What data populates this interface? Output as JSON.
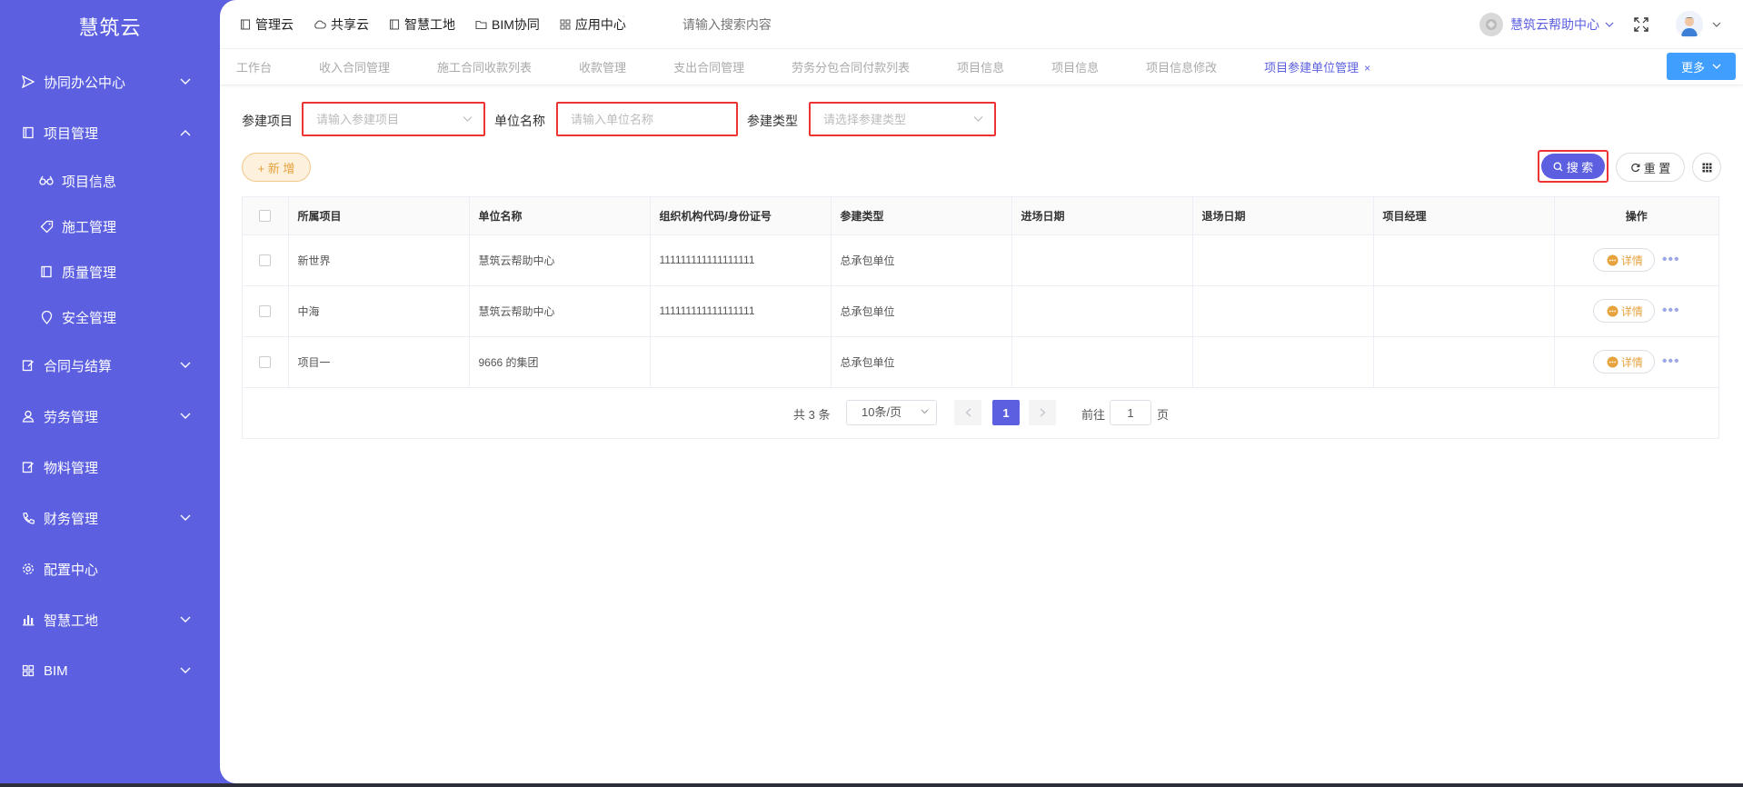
{
  "app": {
    "logo": "慧筑云"
  },
  "sidebar": {
    "items": [
      {
        "label": "协同办公中心",
        "icon": "send-icon",
        "expanded": false
      },
      {
        "label": "项目管理",
        "icon": "book-icon",
        "expanded": true,
        "children": [
          {
            "label": "项目信息",
            "icon": "glasses-icon"
          },
          {
            "label": "施工管理",
            "icon": "tag-icon"
          },
          {
            "label": "质量管理",
            "icon": "book-icon"
          },
          {
            "label": "安全管理",
            "icon": "location-icon"
          }
        ]
      },
      {
        "label": "合同与结算",
        "icon": "edit-icon",
        "expanded": false
      },
      {
        "label": "劳务管理",
        "icon": "user-icon",
        "expanded": false
      },
      {
        "label": "物料管理",
        "icon": "edit-icon"
      },
      {
        "label": "财务管理",
        "icon": "phone-icon",
        "expanded": false
      },
      {
        "label": "配置中心",
        "icon": "gear-icon"
      },
      {
        "label": "智慧工地",
        "icon": "bar-chart-icon",
        "expanded": false
      },
      {
        "label": "BIM",
        "icon": "grid-icon",
        "expanded": false
      }
    ]
  },
  "topnav": {
    "items": [
      {
        "label": "管理云",
        "icon": "book-icon"
      },
      {
        "label": "共享云",
        "icon": "cloud-icon"
      },
      {
        "label": "智慧工地",
        "icon": "book-icon"
      },
      {
        "label": "BIM协同",
        "icon": "folder-icon"
      },
      {
        "label": "应用中心",
        "icon": "grid-icon"
      }
    ],
    "search_placeholder": "请输入搜索内容",
    "help_center": "慧筑云帮助中心"
  },
  "tabs": {
    "items": [
      "工作台",
      "收入合同管理",
      "施工合同收款列表",
      "收款管理",
      "支出合同管理",
      "劳务分包合同付款列表",
      "项目信息",
      "项目信息",
      "项目信息修改"
    ],
    "active": "项目参建单位管理",
    "close": "×",
    "more_label": "更多"
  },
  "filters": {
    "project_label": "参建项目",
    "project_placeholder": "请输入参建项目",
    "unit_label": "单位名称",
    "unit_placeholder": "请输入单位名称",
    "type_label": "参建类型",
    "type_placeholder": "请选择参建类型"
  },
  "actions": {
    "add_label": "+ 新 增",
    "search_label": "搜 索",
    "reset_label": "重 置"
  },
  "table": {
    "columns": [
      "所属项目",
      "单位名称",
      "组织机构代码/身份证号",
      "参建类型",
      "进场日期",
      "退场日期",
      "项目经理",
      "操作"
    ],
    "rows": [
      {
        "project": "新世界",
        "unit": "慧筑云帮助中心",
        "code": "111111111111111111",
        "type": "总承包单位",
        "enter": "",
        "exit": "",
        "manager": "",
        "detail": "详情"
      },
      {
        "project": "中海",
        "unit": "慧筑云帮助中心",
        "code": "111111111111111111",
        "type": "总承包单位",
        "enter": "",
        "exit": "",
        "manager": "",
        "detail": "详情"
      },
      {
        "project": "项目一",
        "unit": "9666 的集团",
        "code": "",
        "type": "总承包单位",
        "enter": "",
        "exit": "",
        "manager": "",
        "detail": "详情"
      }
    ]
  },
  "pagination": {
    "total": "共 3 条",
    "page_size": "10条/页",
    "current_page": "1",
    "goto_label": "前往",
    "goto_value": "1",
    "goto_unit": "页"
  },
  "colors": {
    "primary": "#5b5fe0",
    "accent_orange": "#e6a23c",
    "highlight_border": "#e33333",
    "more_button": "#409eff"
  }
}
